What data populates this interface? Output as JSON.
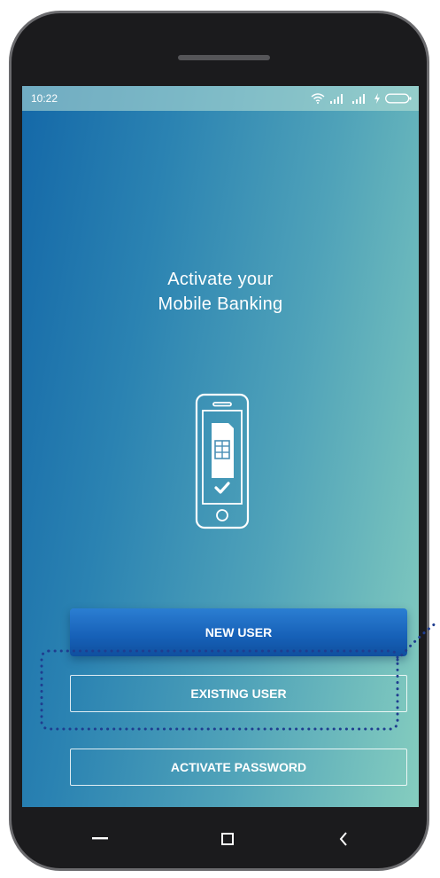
{
  "status_bar": {
    "time": "10:22",
    "icons": [
      "wifi-icon",
      "signal-icon",
      "signal-icon",
      "charging-icon",
      "battery-icon"
    ]
  },
  "header": {
    "title_line1": "Activate your",
    "title_line2": "Mobile Banking"
  },
  "hero": {
    "icon": "phone-sim-check-icon"
  },
  "buttons": {
    "new_user": "NEW USER",
    "existing_user": "EXISTING USER",
    "activate_password": "ACTIVATE PASSWORD"
  },
  "navbar": {
    "icons": [
      "menu-icon",
      "home-square-icon",
      "back-chevron-icon"
    ]
  },
  "colors": {
    "gradient_start": "#1468a8",
    "gradient_end": "#85cdbf",
    "primary_button": "#1660b7",
    "highlight_dotted": "#1f3d8f"
  }
}
